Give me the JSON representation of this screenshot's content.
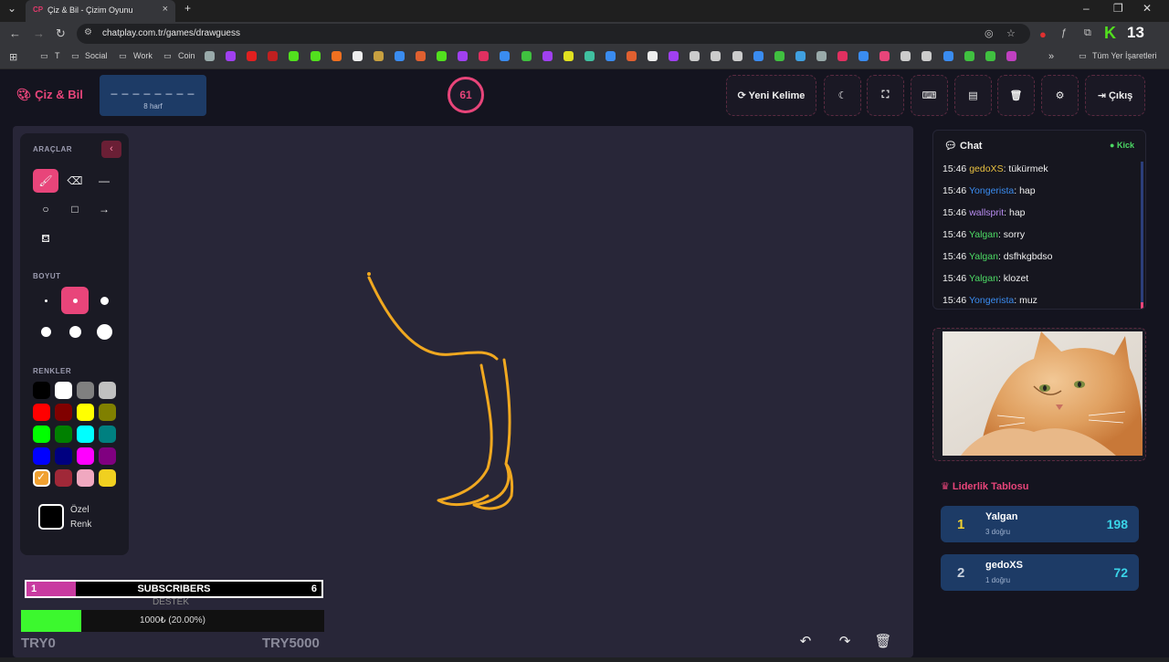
{
  "browser": {
    "tab_title": "Çiz & Bil - Çizim Oyunu",
    "tab_favicon": "CP",
    "url": "chatplay.com.tr/games/drawguess",
    "bookmarks": [
      "T",
      "Social",
      "Work",
      "Coin"
    ],
    "all_bookmarks": "Tüm Yer İşaretleri",
    "ext_badge": "13"
  },
  "app": {
    "logo": "Çiz & Bil",
    "word_mask": "_ _ _ _ _ _ _ _",
    "word_count": "8 harf",
    "timer": "61",
    "buttons": {
      "new_word": "Yeni Kelime",
      "exit": "Çıkış"
    }
  },
  "tools": {
    "title": "ARAÇLAR",
    "size_title": "BOYUT",
    "colors_title": "RENKLER",
    "custom_color_label": "Özel Renk",
    "palette": [
      "#000000",
      "#ffffff",
      "#808080",
      "#c0c0c0",
      "#ff0000",
      "#800000",
      "#ffff00",
      "#808000",
      "#00ff00",
      "#008000",
      "#00ffff",
      "#008080",
      "#0000ff",
      "#000080",
      "#ff00ff",
      "#800080",
      "#f0a030",
      "#a02838",
      "#f0a8c0",
      "#f0d020"
    ],
    "selected_color": "#f0a030"
  },
  "overlay": {
    "sub_left": "1",
    "sub_title": "SUBSCRIBERS",
    "sub_right": "6",
    "destek": "DESTEK",
    "progress_text": "1000₺ (20.00%)",
    "progress_fraction": 0.2,
    "min_label": "TRY0",
    "max_label": "TRY5000"
  },
  "chat": {
    "title": "Chat",
    "status": "Kick",
    "messages": [
      {
        "time": "15:46",
        "user": "gedoXS",
        "color": "#e8c040",
        "text": ": tükürmek"
      },
      {
        "time": "15:46",
        "user": "Yongerista",
        "color": "#3a8cf0",
        "text": ": hap"
      },
      {
        "time": "15:46",
        "user": "wallsprit",
        "color": "#b88cf0",
        "text": ": hap"
      },
      {
        "time": "15:46",
        "user": "Yalgan",
        "color": "#4cd964",
        "text": ": sorry"
      },
      {
        "time": "15:46",
        "user": "Yalgan",
        "color": "#4cd964",
        "text": ": dsfhkgbdso"
      },
      {
        "time": "15:46",
        "user": "Yalgan",
        "color": "#4cd964",
        "text": ": klozet"
      },
      {
        "time": "15:46",
        "user": "Yongerista",
        "color": "#3a8cf0",
        "text": ": muz"
      }
    ]
  },
  "leaderboard": {
    "title": "Liderlik Tablosu",
    "rows": [
      {
        "rank": "1",
        "rank_color": "#f0d030",
        "name": "Yalgan",
        "sub": "3 doğru",
        "score": "198"
      },
      {
        "rank": "2",
        "rank_color": "#c8d0dc",
        "name": "gedoXS",
        "sub": "1 doğru",
        "score": "72"
      }
    ]
  },
  "colors": {
    "accent": "#e8457a",
    "stroke": "#f0a820"
  }
}
